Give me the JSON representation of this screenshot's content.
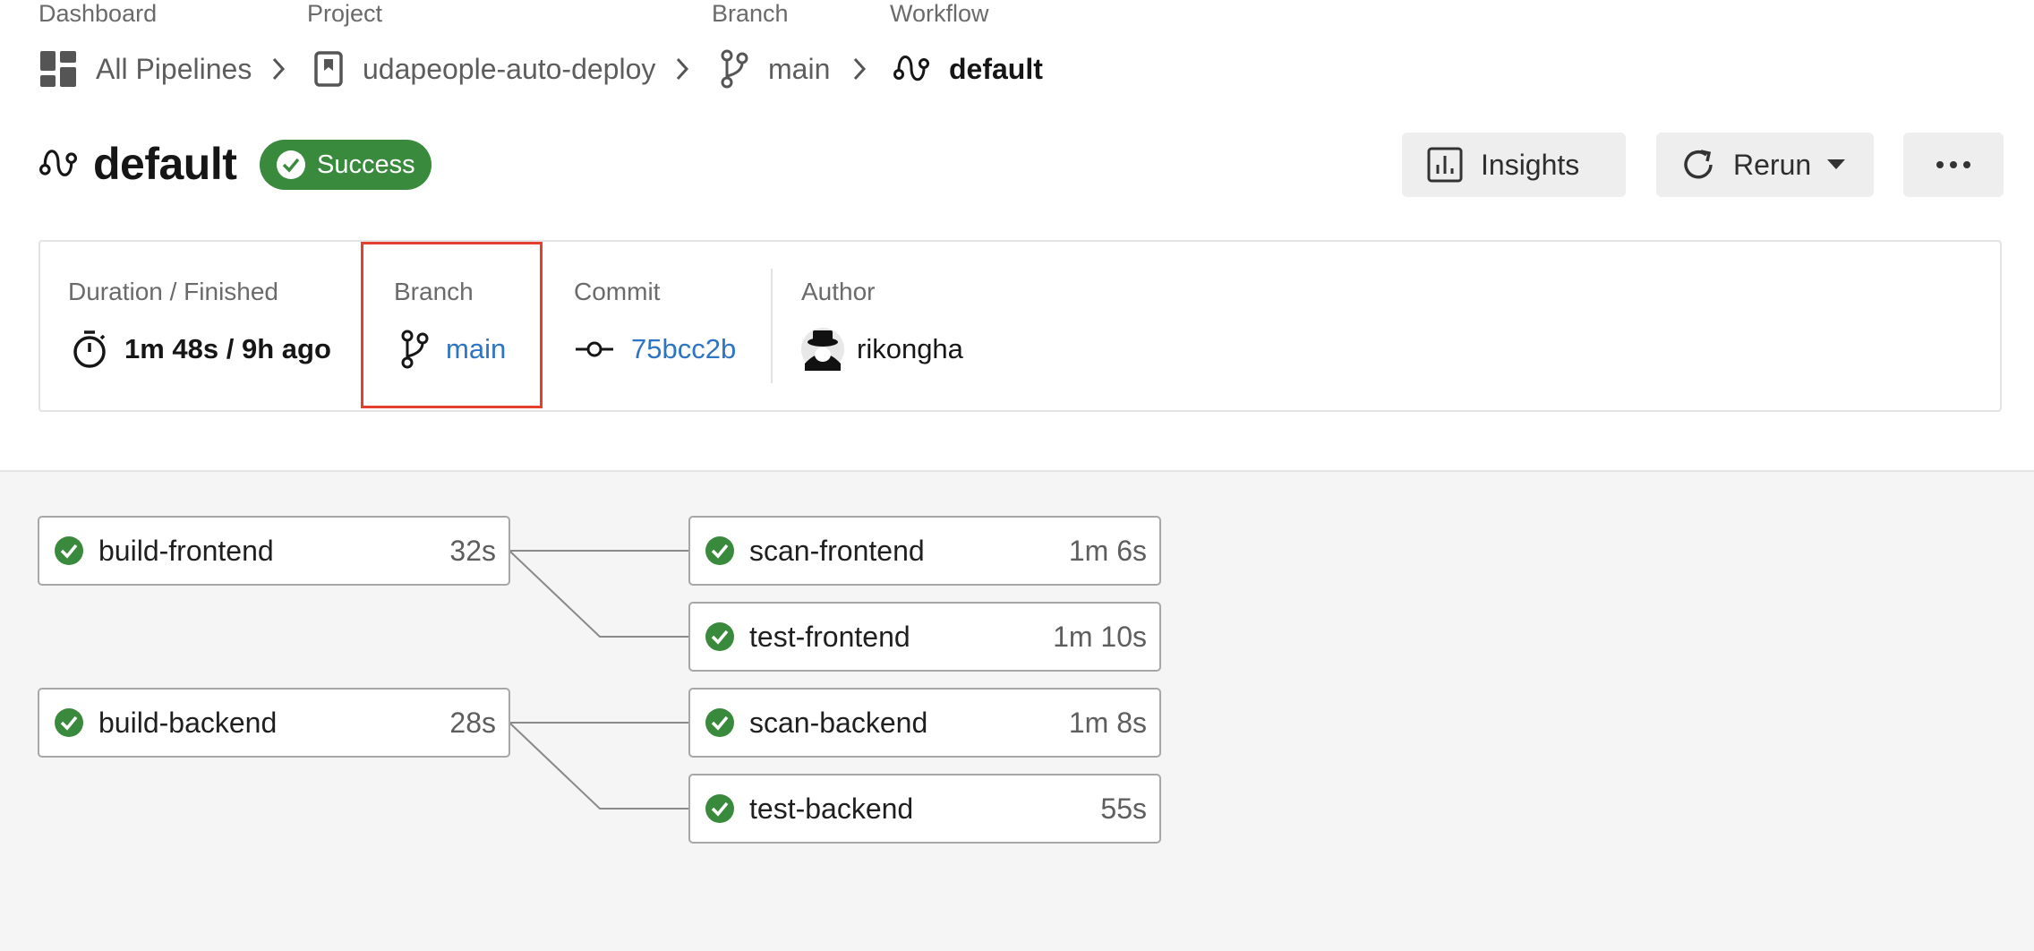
{
  "breadcrumb": {
    "dashboard": {
      "label": "Dashboard",
      "value": "All Pipelines"
    },
    "project": {
      "label": "Project",
      "value": "udapeople-auto-deploy"
    },
    "branch": {
      "label": "Branch",
      "value": "main"
    },
    "workflow": {
      "label": "Workflow",
      "value": "default"
    }
  },
  "header": {
    "title": "default",
    "status": "Success",
    "insights_label": "Insights",
    "rerun_label": "Rerun"
  },
  "info": {
    "duration_label": "Duration / Finished",
    "duration_value": "1m 48s / 9h ago",
    "branch_label": "Branch",
    "branch_value": "main",
    "commit_label": "Commit",
    "commit_value": "75bcc2b",
    "author_label": "Author",
    "author_value": "rikongha"
  },
  "jobs": [
    {
      "name": "build-frontend",
      "duration": "32s"
    },
    {
      "name": "scan-frontend",
      "duration": "1m 6s"
    },
    {
      "name": "test-frontend",
      "duration": "1m 10s"
    },
    {
      "name": "build-backend",
      "duration": "28s"
    },
    {
      "name": "scan-backend",
      "duration": "1m 8s"
    },
    {
      "name": "test-backend",
      "duration": "55s"
    }
  ],
  "colors": {
    "success": "#3a8a3e",
    "link": "#2e74c4",
    "highlight": "#e34030"
  }
}
